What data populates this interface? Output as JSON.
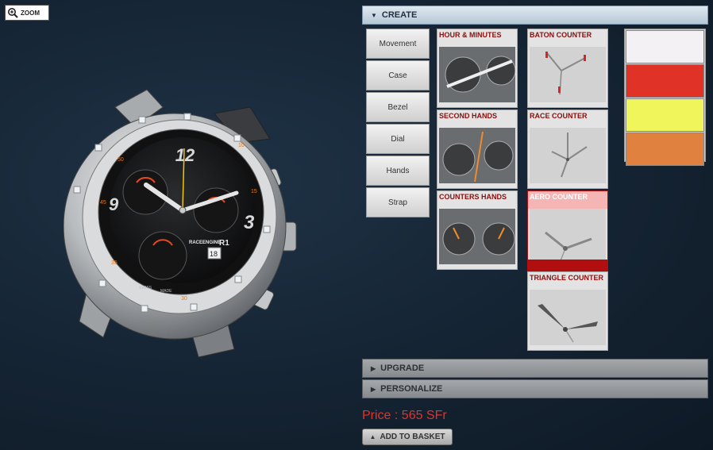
{
  "zoom": {
    "label": "ZOOM",
    "icon": "magnifier-plus-icon"
  },
  "watch": {
    "brand": "RACEENGINE",
    "model": "R1",
    "date": "18",
    "hour_numerals": [
      "12",
      "3",
      "9"
    ],
    "swiss": "SWISS",
    "made": "MADE"
  },
  "accordion": {
    "create": {
      "label": "CREATE",
      "icon": "triangle-down-icon"
    },
    "upgrade": {
      "label": "UPGRADE",
      "icon": "triangle-right-icon"
    },
    "personalize": {
      "label": "PERSONALIZE",
      "icon": "triangle-right-icon"
    }
  },
  "categories": [
    "Movement",
    "Case",
    "Bezel",
    "Dial",
    "Hands",
    "Strap"
  ],
  "hand_options": [
    {
      "label": "HOUR & MINUTES"
    },
    {
      "label": "BATON COUNTER"
    },
    {
      "label": "SECOND HANDS"
    },
    {
      "label": "RACE COUNTER"
    },
    {
      "label": "COUNTERS HANDS"
    },
    {
      "label": "AERO COUNTER",
      "selected": true
    },
    {
      "label": "TRIANGLE COUNTER"
    }
  ],
  "colors": {
    "swatches": [
      "#f3f1f3",
      "#e03226",
      "#eff55a",
      "#e08140"
    ],
    "accent": "#e3332a",
    "option_title": "#8b0e0e"
  },
  "price": {
    "text": "Price : 565 SFr"
  },
  "basket": {
    "label": "ADD TO BASKET",
    "icon": "triangle-up-icon"
  }
}
